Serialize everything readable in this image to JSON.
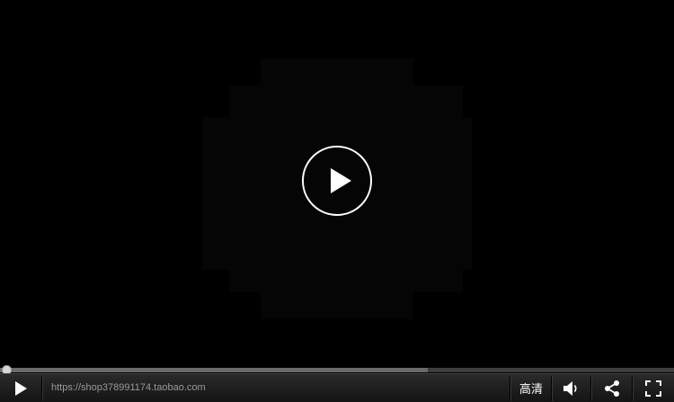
{
  "player": {
    "state": "paused",
    "progress_played": 0,
    "progress_buffered": 0.635,
    "watermark_url": "https://shop378991174.taobao.com",
    "quality_label": "高清",
    "colors": {
      "background": "#000000",
      "controlbar": "#1e1e1e",
      "text_muted": "#9a9a9a",
      "icon": "#ffffff"
    },
    "icons": {
      "big_play": "play-circle-icon",
      "play": "play-icon",
      "volume": "volume-icon",
      "share": "share-icon",
      "fullscreen": "fullscreen-icon"
    }
  }
}
